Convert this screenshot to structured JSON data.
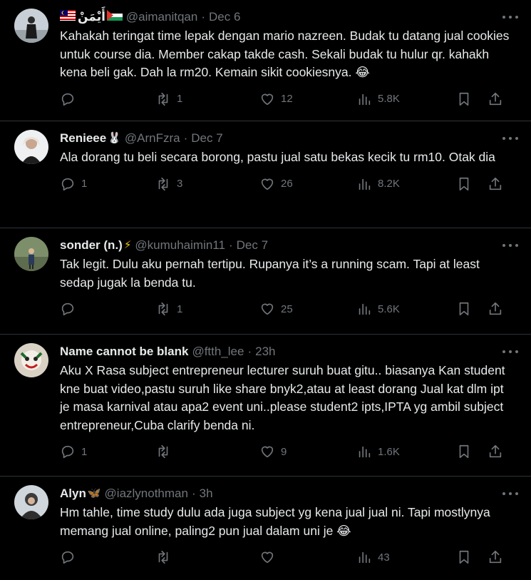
{
  "tweets": [
    {
      "name": "أَيْمَنْ",
      "name_prefix_flag": "malaysia-flag",
      "name_suffix_flag": "palestine-flag",
      "handle": "@aimanitqan",
      "time": "Dec 6",
      "text": "Kahakah teringat time lepak dengan mario nazreen. Budak tu datang jual cookies untuk course dia. Member cakap takde cash. Sekali budak tu hulur qr. kahakh kena beli gak. Dah la rm20. Kemain sikit cookiesnya. 😂",
      "replies": "",
      "retweets": "1",
      "likes": "12",
      "views": "5.8K"
    },
    {
      "name": "Renieee",
      "name_emoji": "🐰",
      "handle": "@ArnFzra",
      "time": "Dec 7",
      "text": "Ala dorang tu beli secara borong, pastu jual satu bekas kecik tu rm10. Otak dia",
      "replies": "1",
      "retweets": "3",
      "likes": "26",
      "views": "8.2K"
    },
    {
      "name": "sonder (n.)",
      "name_emoji": "⚡",
      "handle": "@kumuhaimin11",
      "time": "Dec 7",
      "text": "Tak legit. Dulu aku pernah tertipu. Rupanya it’s a running scam. Tapi at least sedap jugak la benda tu.",
      "replies": "",
      "retweets": "1",
      "likes": "25",
      "views": "5.6K"
    },
    {
      "name": "Name cannot be blank",
      "name_emoji": "",
      "handle": "@ftth_lee",
      "time": "23h",
      "text": "Aku X Rasa subject entrepreneur lecturer suruh buat gitu.. biasanya Kan student kne buat video,pastu suruh like share bnyk2,atau at least dorang Jual kat dlm ipt je masa karnival atau apa2 event uni..please student2 ipts,IPTA yg ambil subject entrepreneur,Cuba clarify benda ni.",
      "replies": "1",
      "retweets": "",
      "likes": "9",
      "views": "1.6K"
    },
    {
      "name": "Alyn",
      "name_emoji": "🦋",
      "handle": "@iazlynothman",
      "time": "3h",
      "text": "Hm tahle, time study dulu ada juga subject yg kena jual jual ni. Tapi mostlynya memang jual online, paling2 pun jual dalam uni je 😂",
      "replies": "",
      "retweets": "",
      "likes": "",
      "views": "43"
    }
  ],
  "colors": {
    "background": "#000000",
    "text": "#e7e9ea",
    "secondary": "#71767b",
    "divider": "#2f3336"
  },
  "icons": [
    "reply-icon",
    "retweet-icon",
    "like-icon",
    "views-icon",
    "bookmark-icon",
    "share-icon",
    "more-icon"
  ]
}
